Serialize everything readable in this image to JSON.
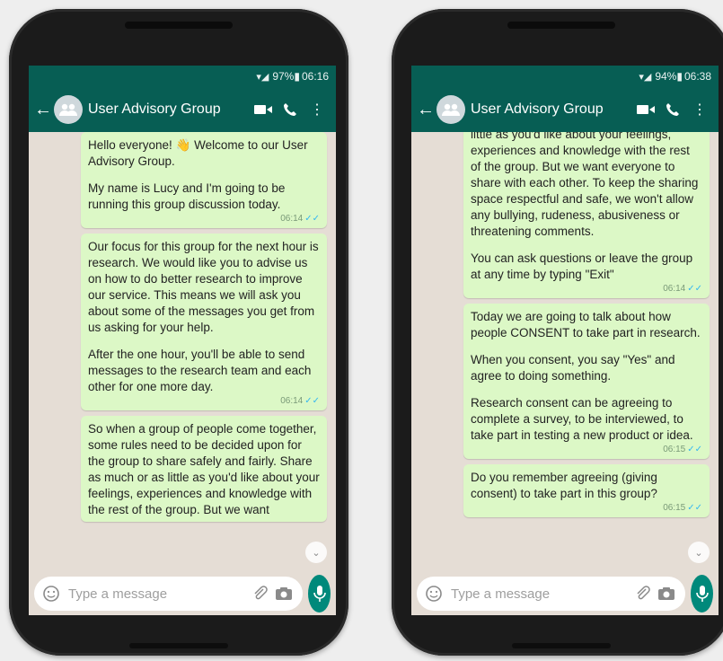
{
  "left": {
    "status": {
      "battery": "97%",
      "time": "06:16"
    },
    "header": {
      "title": "User Advisory Group"
    },
    "messages": [
      {
        "paras": [
          "Hello everyone! 👋 Welcome to our User Advisory Group.",
          "My name is Lucy and I'm going to be running this group discussion today."
        ],
        "time": "06:14"
      },
      {
        "paras": [
          "Our focus for this group for the next hour is research. We would like you to advise us on how to do better research to improve our service. This means we will ask you about some of the messages you get from us asking for your help.",
          "After the one hour, you'll be able to send messages to the research team and each other for one more day."
        ],
        "time": "06:14"
      },
      {
        "paras": [
          "So when a group of people come together, some rules need to be decided upon for the group to share safely and fairly. Share as much or as little as you'd like about your feelings, experiences and knowledge with the rest of the group. But we want"
        ]
      }
    ],
    "input": {
      "placeholder": "Type a message"
    }
  },
  "right": {
    "status": {
      "battery": "94%",
      "time": "06:38"
    },
    "header": {
      "title": "User Advisory Group"
    },
    "messages": [
      {
        "paras": [
          "little as you'd like about your feelings, experiences and knowledge with the rest of the group. But we want everyone to share with each other. To keep the sharing space respectful and safe, we won't allow any bullying, rudeness, abusiveness or threatening comments.",
          "You can ask questions or leave the group at any time by typing \"Exit\""
        ],
        "time": "06:14"
      },
      {
        "paras": [
          "Today we are going to talk about how people CONSENT to take part in research.",
          "When you consent, you say \"Yes\" and agree to doing something.",
          "Research consent can be agreeing to complete a survey, to be interviewed, to take part in testing a new product or idea."
        ],
        "time": "06:15"
      },
      {
        "paras": [
          "Do you remember agreeing (giving consent) to take part in this group?"
        ],
        "time": "06:15"
      }
    ],
    "input": {
      "placeholder": "Type a message"
    }
  },
  "colors": {
    "header": "#075e54",
    "bubble": "#dcf8c6",
    "mic": "#00897b",
    "chat_bg": "#e5ddd5"
  }
}
